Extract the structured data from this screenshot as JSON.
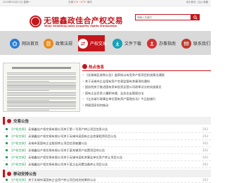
{
  "topbar": {
    "date": "2020年02月21日 星期一",
    "weather_label": "无锡",
    "weather_temp": "2℃~17℃",
    "weather_wind": "南风",
    "links": "设为首页 | 加入收藏"
  },
  "header": {
    "logo_cn": "无锡鑫政佳合产权交易",
    "logo_en": "Wuxi Xinzheng Jiahe property rights transaction",
    "search_placeholder": "请输入关键字"
  },
  "nav": {
    "items": [
      {
        "label": "网站首页",
        "icon": "home-icon"
      },
      {
        "label": "政策法规",
        "icon": "policy-icon"
      },
      {
        "label": "产权交易",
        "icon": "trade-icon"
      },
      {
        "label": "文件下载",
        "icon": "download-icon"
      },
      {
        "label": "办事指南",
        "icon": "guide-icon"
      },
      {
        "label": "联系我们",
        "icon": "contact-icon"
      }
    ],
    "active_index": 2
  },
  "notice": {
    "title": "热点信息",
    "items": [
      "《无锡城区收购公告》盖章拟以有竞争产权项目拍卖情况通报",
      "关于无锡市企业国有资产交易监管有关事项的通知",
      "国务院关于推进国有资本投资运营公司改革试点的实施意见",
      "国有企业负责人履职待遇、业务支出管理办法",
      "《江苏省行政事业单位国有资产管理办法》今日起施行",
      "明星国家如何推动"
    ]
  },
  "transactions": {
    "title": "交易公告",
    "items": [
      {
        "category": "【产权交易】",
        "title": "无锡鑫佳产权交易有限公司关于第一号资产转让项目信息公告",
        "date": "202"
      },
      {
        "category": "【产权交易】",
        "title": "无锡鑫佳产权交易有限公司关于无锡市某国有企业房屋租赁项目公告",
        "date": "202"
      },
      {
        "category": "【产权交易】",
        "title": "无锡市某国有企业股权转让项目信息披露公告",
        "date": "202"
      },
      {
        "category": "【产权交易】",
        "title": "无锡鑫佳产权交易有限公司关于某车辆资产处置项目的公告",
        "date": "202"
      },
      {
        "category": "【产权交易】",
        "title": "无锡鑫佳产权交易有限公司关于无锡市某机关事业单位资产转让项目公告",
        "date": "202"
      },
      {
        "category": "【产权交易】",
        "title": "无锡鑫佳产权交易有限公司关于某企业闲置设备转让项目公告",
        "date": "202"
      }
    ]
  },
  "results": {
    "title": "移动安排公告",
    "items": [
      {
        "category": "【产权交易】",
        "title": "关于无锡市某国有企业资产转让项目成交结果的公示",
        "date": "202"
      }
    ]
  },
  "colors": {
    "brand": "#c4161c",
    "nav_bg": "#d9d9d9",
    "list_accent": "#2e9e5b"
  }
}
